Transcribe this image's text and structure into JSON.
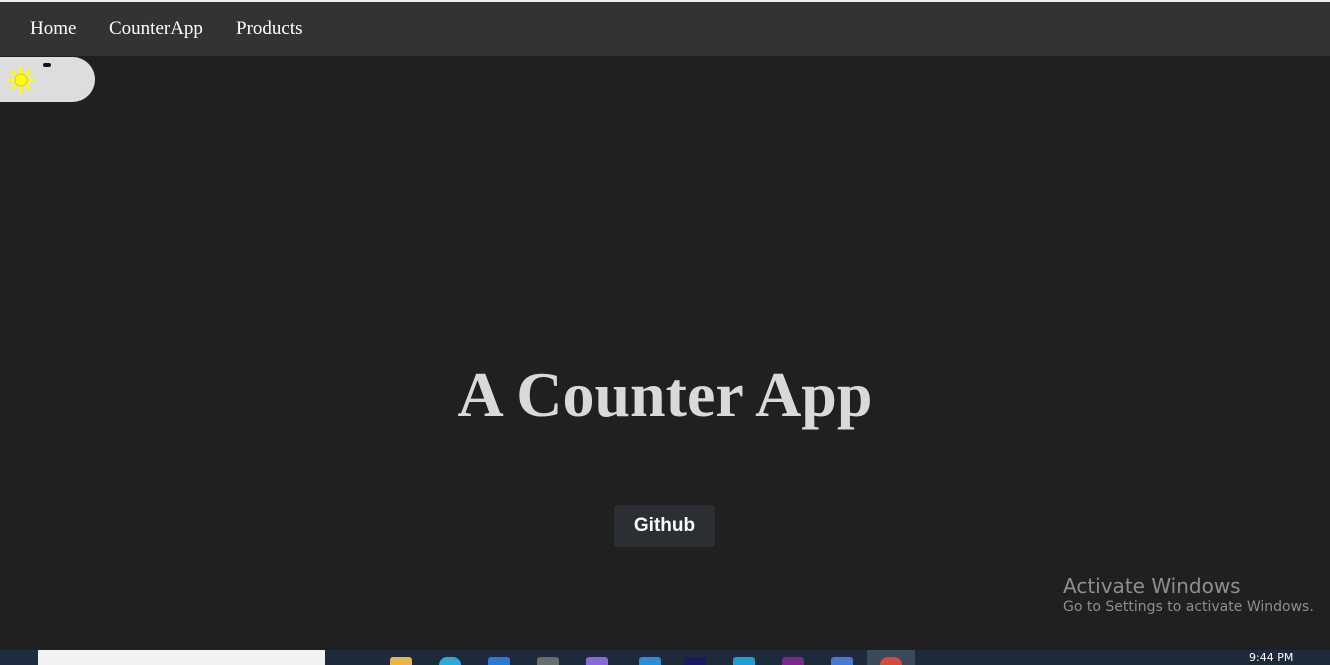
{
  "navbar": {
    "links": [
      "Home",
      "CounterApp",
      "Products"
    ]
  },
  "theme_toggle": {
    "icon": "sun-icon",
    "sun_color": "#ffff00"
  },
  "main": {
    "title": "A Counter App",
    "github_label": "Github"
  },
  "watermark": {
    "title": "Activate Windows",
    "subtitle": "Go to Settings to activate Windows."
  },
  "taskbar": {
    "clock": "9:44 PM",
    "pinned_icons": [
      "file-explorer-icon",
      "edge-icon",
      "store-icon",
      "calculator-icon",
      "app-icon",
      "vscode-icon",
      "app-icon",
      "app-icon",
      "app-icon",
      "app-icon",
      "chrome-icon"
    ]
  },
  "colors": {
    "background": "#202020",
    "navbar": "#333333",
    "title_text": "#d9d9d9",
    "button_bg": "#2b2e33"
  }
}
